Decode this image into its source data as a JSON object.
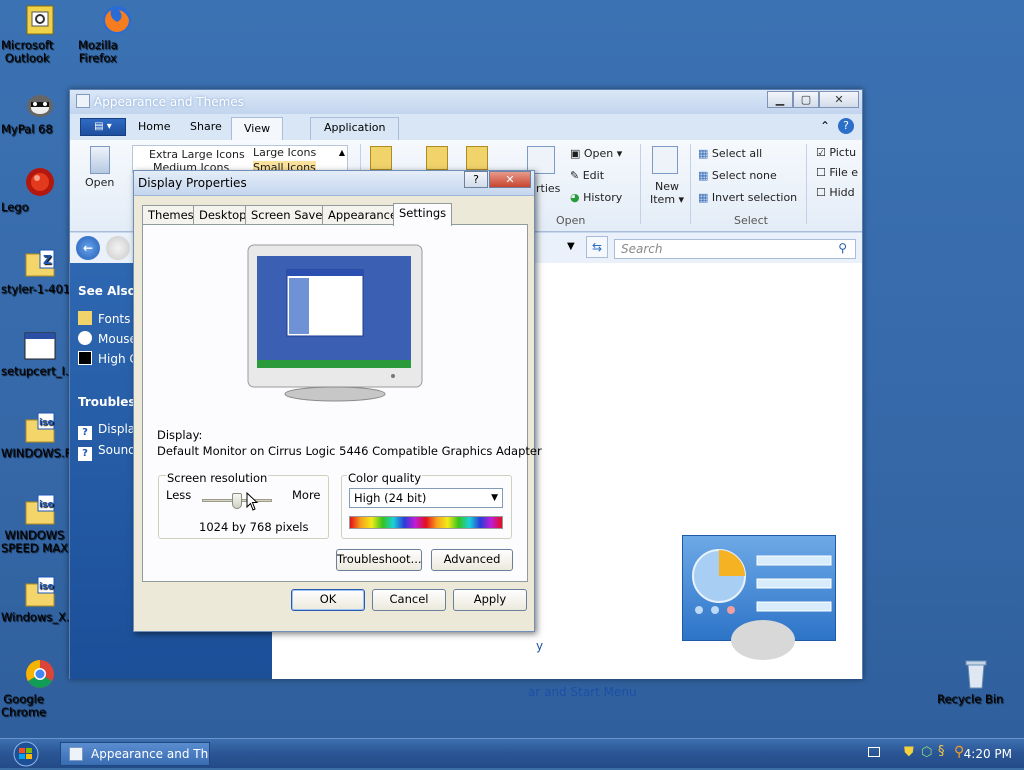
{
  "desktop": {
    "icons": [
      {
        "label": "Microsoft\nOutlook"
      },
      {
        "label": "Mozilla\nFirefox"
      },
      {
        "label": "MyPal 68"
      },
      {
        "label": "Lego"
      },
      {
        "label": "styler-1-401-..."
      },
      {
        "label": "setupcert_I..."
      },
      {
        "label": "WINDOWS.F..."
      },
      {
        "label": "WINDOWS\nSPEED MAX"
      },
      {
        "label": "Windows_X..."
      },
      {
        "label": "Google\nChrome"
      },
      {
        "label": "Recycle Bin"
      }
    ]
  },
  "explorer": {
    "title": "Appearance and Themes",
    "tabs": {
      "home": "Home",
      "share": "Share",
      "view": "View",
      "application": "Application"
    },
    "ribbon": {
      "open": "Open",
      "layout": {
        "extra_large": "Extra Large Icons",
        "large": "Large Icons",
        "medium": "Medium Icons",
        "small": "Small Icons"
      },
      "properties": "Properties",
      "open_menu": "Open",
      "edit": "Edit",
      "history": "History",
      "new_item": "New\nItem",
      "open_group": "Open",
      "select_all": "Select all",
      "select_none": "Select none",
      "invert_selection": "Invert selection",
      "select_group": "Select",
      "pictures": "Pictu",
      "file_ext": "File e",
      "hidden": "Hidd"
    },
    "search_placeholder": "Search",
    "left_pane": {
      "see_also": "See Also",
      "fonts": "Fonts",
      "mouse": "Mouse",
      "high": "High C",
      "troubleshooters": "Troublesh",
      "display": "Display",
      "sound": "Sound"
    },
    "content": {
      "link1": "y",
      "link2": "ar and Start Menu"
    }
  },
  "dialog": {
    "title": "Display Properties",
    "tabs": [
      "Themes",
      "Desktop",
      "Screen Saver",
      "Appearance",
      "Settings"
    ],
    "display_label": "Display:",
    "display_value": "Default Monitor on Cirrus Logic 5446 Compatible Graphics Adapter",
    "screen_resolution": {
      "title": "Screen resolution",
      "less": "Less",
      "more": "More",
      "value": "1024 by 768 pixels"
    },
    "color_quality": {
      "title": "Color quality",
      "selected": "High (24 bit)"
    },
    "troubleshoot": "Troubleshoot...",
    "advanced": "Advanced",
    "ok": "OK",
    "cancel": "Cancel",
    "apply": "Apply"
  },
  "taskbar": {
    "task_label": "Appearance and Th...",
    "clock": "4:20 PM"
  }
}
